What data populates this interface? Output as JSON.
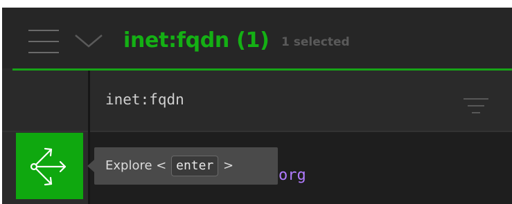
{
  "header": {
    "title": "inet:fqdn (1)",
    "selected_text": "1 selected",
    "accent_color": "#14b014"
  },
  "column": {
    "title": "inet:fqdn"
  },
  "row": {
    "cell_text_visible": "org"
  },
  "explore": {
    "tooltip_label": "Explore",
    "open_bracket": "<",
    "key": "enter",
    "close_bracket": ">",
    "button_color": "#0fa80f"
  },
  "icons": {
    "menu": "hamburger-menu-icon",
    "chevron": "chevron-down-icon",
    "filter": "filter-icon",
    "explore": "explore-network-icon"
  }
}
